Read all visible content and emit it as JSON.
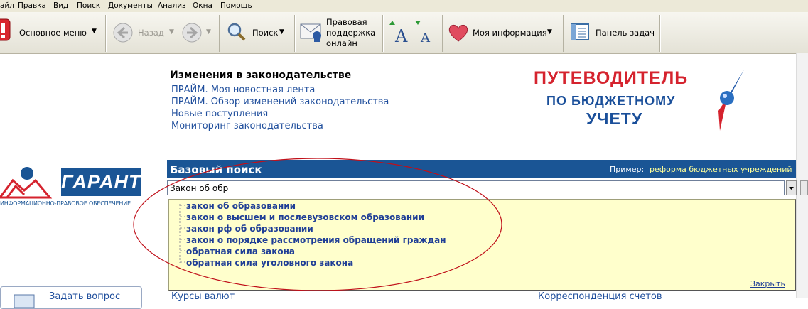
{
  "menu": [
    "айл",
    "Правка",
    "Вид",
    "Поиск",
    "Документы",
    "Анализ",
    "Окна",
    "Помощь"
  ],
  "toolbar": {
    "main_menu": "Основное меню",
    "back": "Назад",
    "search": "Поиск",
    "legal_support_line1": "Правовая",
    "legal_support_line2": "поддержка",
    "legal_support_line3": "онлайн",
    "my_info": "Моя информация",
    "task_panel": "Панель задач"
  },
  "news": {
    "title": "Изменения в законодательстве",
    "links": [
      "ПРАЙМ. Моя новостная лента",
      "ПРАЙМ. Обзор изменений законодательства",
      "Новые поступления",
      "Мониторинг законодательства"
    ]
  },
  "guide_banner": {
    "line1": "ПУТЕВОДИТЕЛЬ",
    "line2": "ПО БЮДЖЕТНОМУ",
    "line3": "УЧЕТУ"
  },
  "garant": {
    "logo_text": "ГАРАНТ",
    "subtitle": "ИНФОРМАЦИОННО-ПРАВОВОЕ ОБЕСПЕЧЕНИЕ"
  },
  "search": {
    "title": "Базовый поиск",
    "example_label": "Пример:",
    "example_link": "реформа бюджетных учреждений",
    "query": "Закон об обр",
    "suggestions": [
      "закон об образовании",
      "закон о высшем и послевузовском образовании",
      "закон рф об образовании",
      "закон о порядке рассмотрения обращений граждан",
      "обратная сила закона",
      "обратная сила уголовного закона"
    ],
    "close": "Закрыть"
  },
  "bottom": {
    "ask_question": "Задать вопрос",
    "currency": "Курсы валют",
    "accounts": "Корреспонденция счетов"
  },
  "colors": {
    "search_band": "#1a5595",
    "suggest_bg": "#ffffcc",
    "link": "#1f4e9c",
    "annotation_ellipse": "#c0101a",
    "guide_red": "#d5232e",
    "guide_blue": "#1a4f9a"
  }
}
